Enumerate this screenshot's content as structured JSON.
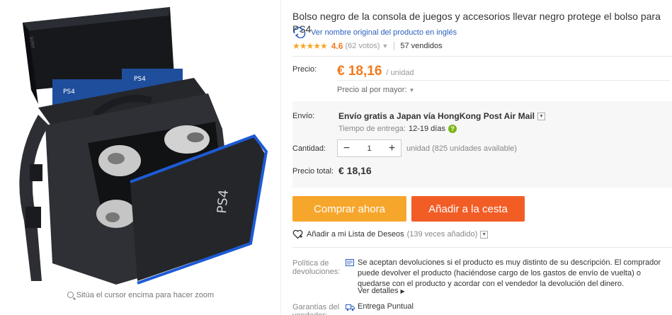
{
  "product": {
    "title": "Bolso negro de la consola de juegos y accesorios llevar negro protege el bolso para PS4",
    "view_original": "Ver nombre original del producto en inglés",
    "stars": "★★★★★",
    "rating": "4.6",
    "votes": "(62 votos)",
    "sold": "57 vendidos",
    "image_alt": "PS4 carrying bag"
  },
  "price": {
    "label": "Precio:",
    "amount": "€ 18,16",
    "unit": "/ unidad",
    "wholesale": "Precio al por mayor:"
  },
  "shipping": {
    "label": "Envío:",
    "method": "Envío gratis a Japan vía HongKong Post Air Mail",
    "eta_label": "Tiempo de entrega:",
    "eta_days": "12-19 días"
  },
  "quantity": {
    "label": "Cantidad:",
    "value": "1",
    "minus": "−",
    "plus": "+",
    "available": "unidad (825 unidades available)"
  },
  "total": {
    "label": "Precio total:",
    "amount": "€ 18,16"
  },
  "actions": {
    "buy_now": "Comprar ahora",
    "add_to_cart": "Añadir a la cesta",
    "wishlist": "Añadir a mi Lista de Deseos",
    "wishlist_count": "(139 veces añadido)"
  },
  "returns": {
    "label": "Política de devoluciones:",
    "text": "Se aceptan devoluciones si el producto es muy distinto de su descripción. El comprador puede devolver el producto (haciéndose cargo de los gastos de envío de vuelta) o quedarse con el producto y acordar con el vendedor la devolución del dinero.",
    "more": "Ver detalles"
  },
  "guarantee": {
    "label": "Garantías del vendedor:",
    "text": "Entrega Puntual"
  },
  "gallery": {
    "zoom_hint": "Sitúa el cursor encima para hacer zoom"
  },
  "colors": {
    "orange": "#f07a1e",
    "buy_button": "#f7a62c",
    "cart_button": "#f25d26",
    "link": "#2a5fbd"
  }
}
